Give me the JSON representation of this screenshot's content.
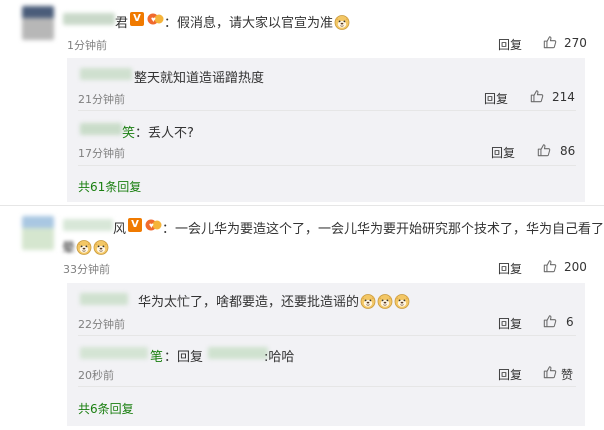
{
  "comments": [
    {
      "name_visible": "君",
      "text": "：假消息，请大家以官宣为准",
      "time": "1分钟前",
      "reply": "回复",
      "likes": "270",
      "replies": [
        {
          "name_visible": "",
          "text": "整天就知道造谣蹭热度",
          "time": "21分钟前",
          "reply": "回复",
          "likes": "214"
        },
        {
          "name_visible": "笑",
          "text": "：丢人不?",
          "time": "17分钟前",
          "reply": "回复",
          "likes": "86"
        }
      ],
      "more_replies": "共61条回复"
    },
    {
      "name_visible": "风",
      "text": "：一会儿华为要造这个了，一会儿华为要开始研究那个技术了，华为自己看了都",
      "text2": "晕",
      "time": "33分钟前",
      "reply": "回复",
      "likes": "200",
      "replies": [
        {
          "name_visible": "",
          "text": "华为太忙了，啥都要造，还要批造谣的",
          "time": "22分钟前",
          "reply": "回复",
          "likes": "6"
        },
        {
          "name_visible": "笔",
          "text": "：回复",
          "text_end": ":哈哈",
          "time": "20秒前",
          "reply": "回复",
          "likes": "赞"
        }
      ],
      "more_replies": "共6条回复"
    }
  ],
  "colors": {
    "link": "#1a7f10",
    "meta": "#808080",
    "reply_bg": "#f2f2f5",
    "vip_badge": "#f07a00"
  },
  "icons": {
    "like": "thumb-up-icon",
    "emoji": "doge-emoji-icon",
    "verified": "v-badge-icon"
  }
}
